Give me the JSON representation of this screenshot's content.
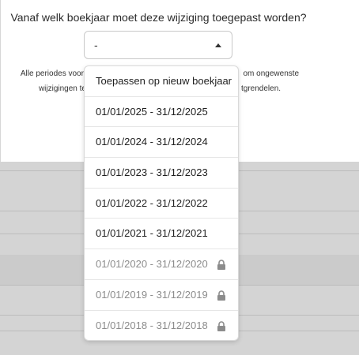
{
  "dialog": {
    "question": "Vanaf welk boekjaar moet deze wijziging toegepast worden?",
    "select_value": "-",
    "info_line1": "Alle periodes voora  om ongewenste",
    "info_line1_left": "Alle periodes voora",
    "info_line1_right": "om ongewenste",
    "info_line2_left": "wijzigingen te",
    "info_line2_right": "tgrendelen."
  },
  "dropdown": {
    "options": [
      {
        "label": "Toepassen op nieuw boekjaar",
        "locked": false
      },
      {
        "label": "01/01/2025 - 31/12/2025",
        "locked": false
      },
      {
        "label": "01/01/2024 - 31/12/2024",
        "locked": false
      },
      {
        "label": "01/01/2023 - 31/12/2023",
        "locked": false
      },
      {
        "label": "01/01/2022 - 31/12/2022",
        "locked": false
      },
      {
        "label": "01/01/2021 - 31/12/2021",
        "locked": false
      },
      {
        "label": "01/01/2020 - 31/12/2020",
        "locked": true
      },
      {
        "label": "01/01/2019 - 31/12/2019",
        "locked": true
      },
      {
        "label": "01/01/2018 - 31/12/2018",
        "locked": true
      }
    ],
    "lock_icon": "lock-icon"
  },
  "colors": {
    "backdrop": "#d4d4d4",
    "locked_text": "#8c8c8c"
  }
}
